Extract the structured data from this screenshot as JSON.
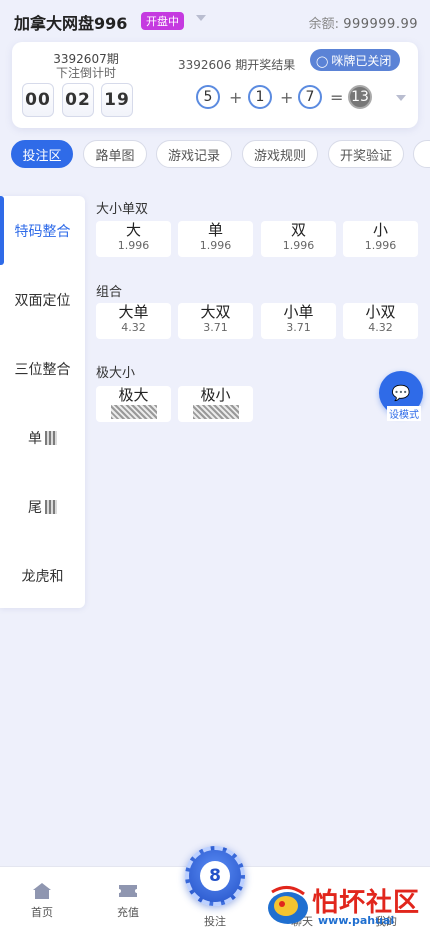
{
  "header": {
    "title": "加拿大网盘996",
    "status": "开盘中",
    "balance_label": "余额:",
    "balance_value": "999999.99"
  },
  "draw": {
    "current_period": "3392607期",
    "countdown_label": "下注倒计时",
    "countdown": [
      "00",
      "02",
      "19"
    ],
    "last_result_label": "3392606 期开奖结果",
    "sound_label": "咪牌已关闭",
    "balls": [
      "5",
      "1",
      "7"
    ],
    "sum": "13",
    "plus": "+",
    "equals": "="
  },
  "tabs": [
    "投注区",
    "路单图",
    "游戏记录",
    "游戏规则",
    "开奖验证"
  ],
  "sidenav": [
    "特码整合",
    "双面定位",
    "三位整合",
    "单",
    "尾",
    "龙虎和"
  ],
  "sections": {
    "size_parity": {
      "title": "大小单双",
      "items": [
        {
          "label": "大",
          "odds": "1.996"
        },
        {
          "label": "单",
          "odds": "1.996"
        },
        {
          "label": "双",
          "odds": "1.996"
        },
        {
          "label": "小",
          "odds": "1.996"
        }
      ]
    },
    "combo": {
      "title": "组合",
      "items": [
        {
          "label": "大单",
          "odds": "4.32"
        },
        {
          "label": "大双",
          "odds": "3.71"
        },
        {
          "label": "小单",
          "odds": "3.71"
        },
        {
          "label": "小双",
          "odds": "4.32"
        }
      ]
    },
    "extreme": {
      "title": "极大小",
      "items": [
        {
          "label": "极大"
        },
        {
          "label": "极小"
        }
      ]
    }
  },
  "fab": {
    "label": "设模式"
  },
  "bottom_nav": [
    "首页",
    "充值",
    "投注",
    "聊天",
    "我的"
  ],
  "watermark": {
    "text": "怕坏社区",
    "url": "www.pahuai"
  },
  "colors": {
    "accent": "#2f6be8",
    "status": "#c53ae0",
    "watermark": "#e1261c"
  }
}
